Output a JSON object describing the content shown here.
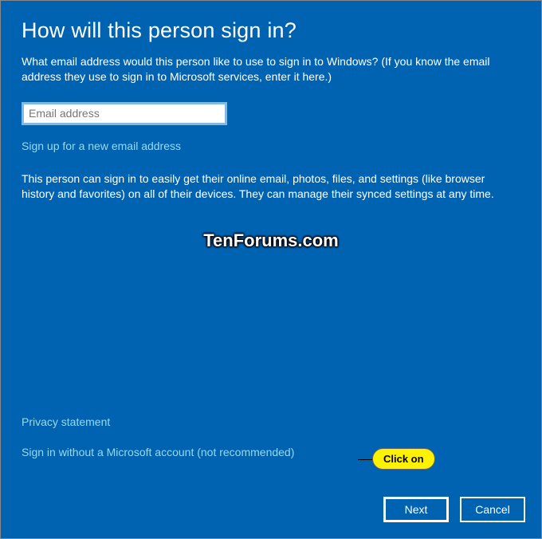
{
  "heading": "How will this person sign in?",
  "description": "What email address would this person like to use to sign in to Windows? (If you know the email address they use to sign in to Microsoft services, enter it here.)",
  "email": {
    "placeholder": "Email address",
    "value": ""
  },
  "signup_link": "Sign up for a new email address",
  "info_text": "This person can sign in to easily get their online email, photos, files, and settings (like browser history and favorites) on all of their devices. They can manage their synced settings at any time.",
  "watermark": "TenForums.com",
  "privacy_link": "Privacy statement",
  "signin_without_link": "Sign in without a Microsoft account (not recommended)",
  "callout_text": "Click on",
  "buttons": {
    "next": "Next",
    "cancel": "Cancel"
  }
}
